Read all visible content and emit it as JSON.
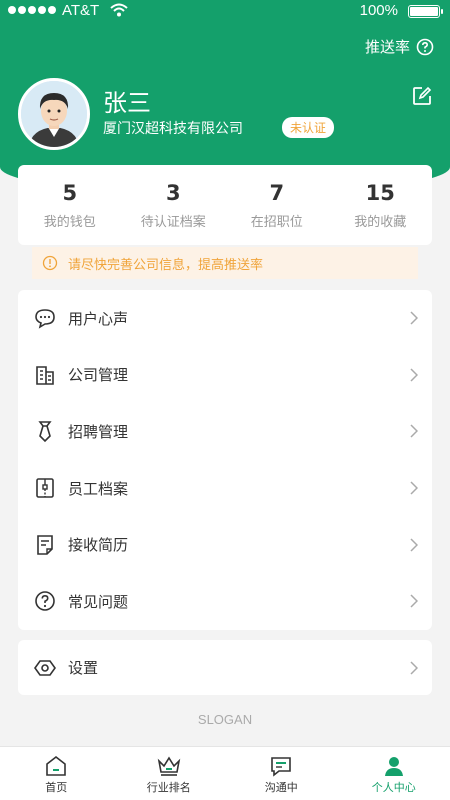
{
  "status_bar": {
    "carrier": "AT&T",
    "battery": "100%"
  },
  "header": {
    "push_rate_label": "推送率",
    "user_name": "张三",
    "company": "厦门汉超科技有限公司",
    "cert_badge": "未认证"
  },
  "stats": [
    {
      "value": "5",
      "label": "我的钱包"
    },
    {
      "value": "3",
      "label": "待认证档案"
    },
    {
      "value": "7",
      "label": "在招职位"
    },
    {
      "value": "15",
      "label": "我的收藏"
    }
  ],
  "notice": "请尽快完善公司信息，提高推送率",
  "menu": [
    {
      "label": "用户心声",
      "icon": "chat-icon"
    },
    {
      "label": "公司管理",
      "icon": "building-icon"
    },
    {
      "label": "招聘管理",
      "icon": "tie-icon"
    },
    {
      "label": "员工档案",
      "icon": "archive-icon"
    },
    {
      "label": "接收简历",
      "icon": "resume-icon"
    },
    {
      "label": "常见问题",
      "icon": "question-icon"
    }
  ],
  "settings": {
    "label": "设置",
    "icon": "settings-icon"
  },
  "slogan": "SLOGAN",
  "tabs": [
    {
      "label": "首页",
      "icon": "home-icon"
    },
    {
      "label": "行业排名",
      "icon": "crown-icon"
    },
    {
      "label": "沟通中",
      "icon": "message-icon"
    },
    {
      "label": "个人中心",
      "icon": "person-icon"
    }
  ],
  "colors": {
    "primary": "#14a06b",
    "warning": "#f0a43a",
    "background": "#f3f3f3"
  }
}
